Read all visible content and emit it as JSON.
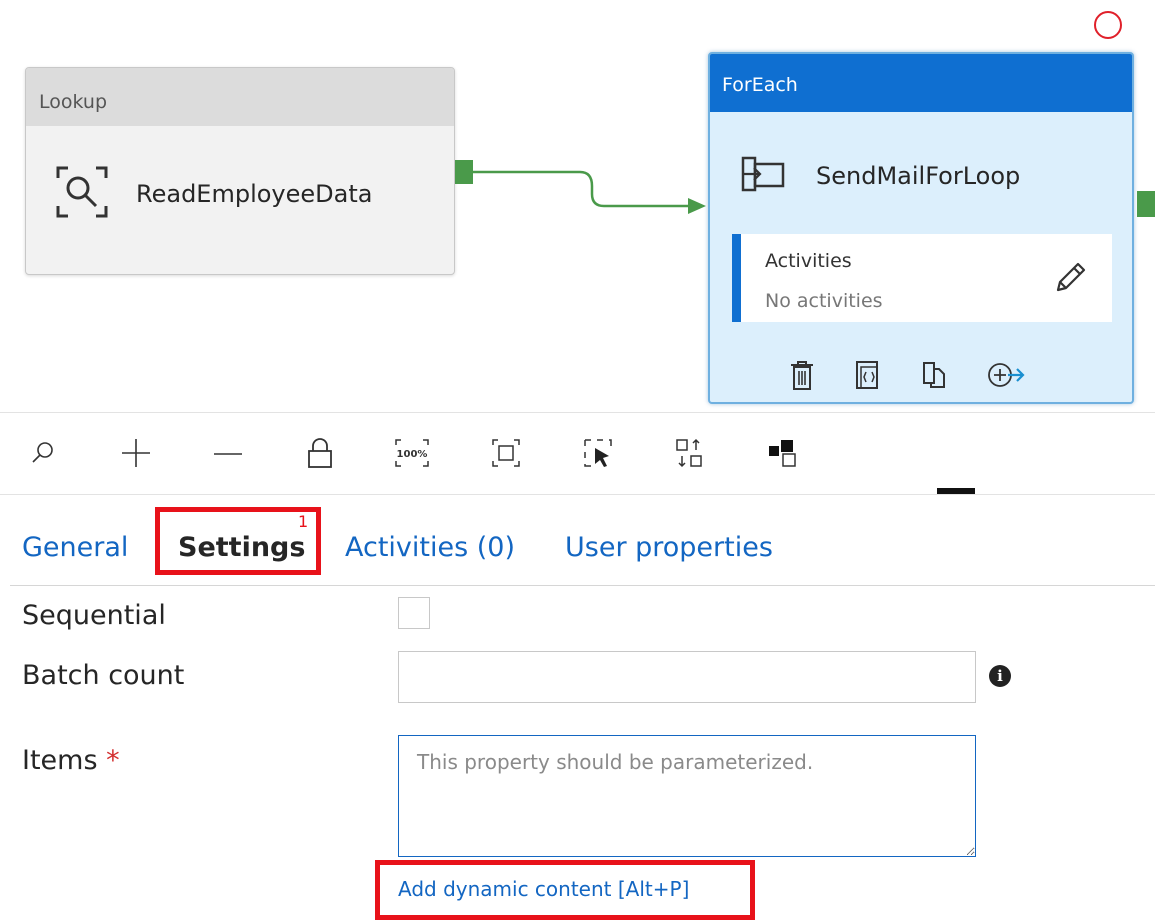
{
  "canvas": {
    "lookup_node": {
      "type_label": "Lookup",
      "name": "ReadEmployeeData"
    },
    "foreach_node": {
      "type_label": "ForEach",
      "name": "SendMailForLoop",
      "activities_title": "Activities",
      "activities_value": "No activities"
    }
  },
  "toolbar": {
    "items": [
      "search-icon",
      "zoom-in-icon",
      "zoom-out-icon",
      "lock-icon",
      "zoom-100-icon",
      "fit-to-screen-icon",
      "select-icon",
      "auto-align-icon",
      "layout-icon"
    ],
    "zoom_100_label": "100%"
  },
  "tabs": {
    "general": "General",
    "settings": "Settings",
    "settings_badge": "1",
    "activities": "Activities (0)",
    "user_properties": "User properties"
  },
  "form": {
    "sequential_label": "Sequential",
    "batch_count_label": "Batch count",
    "batch_count_value": "",
    "items_label": "Items",
    "items_required_mark": "*",
    "items_placeholder": "This property should be parameterized.",
    "info_glyph": "i",
    "dynamic_content_link": "Add dynamic content [Alt+P]"
  },
  "colors": {
    "accent": "#1366c2",
    "foreach_header": "#0f6fd1",
    "connector": "#4a9a4a",
    "highlight": "#e8121a"
  }
}
